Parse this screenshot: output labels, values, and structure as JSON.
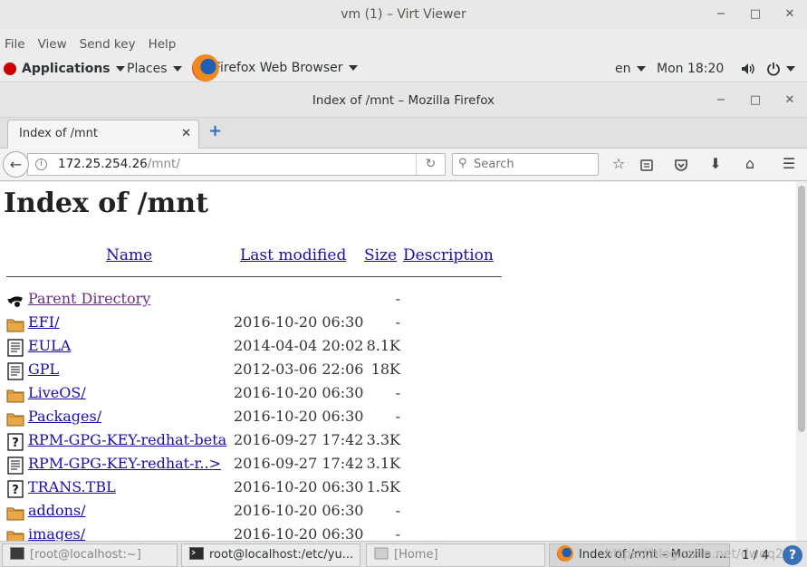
{
  "virt_viewer": {
    "title": "vm (1) – Virt Viewer",
    "menu": [
      "File",
      "View",
      "Send key",
      "Help"
    ]
  },
  "gnome_topbar": {
    "applications": "Applications",
    "places": "Places",
    "browser_app": "Firefox Web Browser",
    "language": "en",
    "clock": "Mon 18:20"
  },
  "firefox": {
    "window_title": "Index of /mnt – Mozilla Firefox",
    "tab_label": "Index of /mnt",
    "url_host": "172.25.254.26",
    "url_path": "/mnt/",
    "search_placeholder": "Search"
  },
  "page": {
    "title": "Index of /mnt",
    "columns": [
      "Name",
      "Last modified",
      "Size",
      "Description"
    ],
    "rows": [
      {
        "icon": "back-icon",
        "name": "Parent Directory",
        "date": "",
        "size": "-"
      },
      {
        "icon": "folder-icon",
        "name": "EFI/",
        "date": "2016-10-20 06:30",
        "size": "-"
      },
      {
        "icon": "text-icon",
        "name": "EULA",
        "date": "2014-04-04 20:02",
        "size": "8.1K"
      },
      {
        "icon": "text-icon",
        "name": "GPL",
        "date": "2012-03-06 22:06",
        "size": "18K"
      },
      {
        "icon": "folder-icon",
        "name": "LiveOS/",
        "date": "2016-10-20 06:30",
        "size": "-"
      },
      {
        "icon": "folder-icon",
        "name": "Packages/",
        "date": "2016-10-20 06:30",
        "size": "-"
      },
      {
        "icon": "unknown-icon",
        "name": "RPM-GPG-KEY-redhat-beta",
        "date": "2016-09-27 17:42",
        "size": "3.3K"
      },
      {
        "icon": "text-icon",
        "name": "RPM-GPG-KEY-redhat-r..>",
        "date": "2016-09-27 17:42",
        "size": "3.1K"
      },
      {
        "icon": "unknown-icon",
        "name": "TRANS.TBL",
        "date": "2016-10-20 06:30",
        "size": "1.5K"
      },
      {
        "icon": "folder-icon",
        "name": "addons/",
        "date": "2016-10-20 06:30",
        "size": "-"
      },
      {
        "icon": "folder-icon",
        "name": "images/",
        "date": "2016-10-20 06:30",
        "size": "-"
      }
    ]
  },
  "taskbar": {
    "items": [
      "[root@localhost:~]",
      "root@localhost:/etc/yu...",
      "[Home]",
      "Index of /mnt – Mozilla ..."
    ],
    "pager": "1 / 4",
    "help": "?",
    "watermark": "https://blog.csdn.net/dwqq233"
  }
}
